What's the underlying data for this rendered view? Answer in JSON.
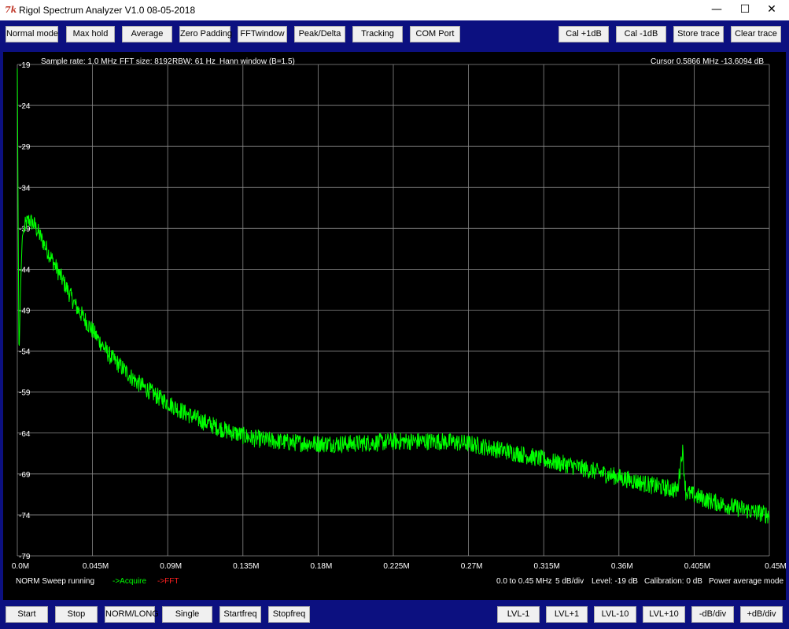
{
  "window": {
    "icon": "tk-feather-icon",
    "title": "Rigol Spectrum Analyzer V1.0 08-05-2018",
    "minimize": "—",
    "maximize": "☐",
    "close": "✕"
  },
  "toolbar_top": {
    "left_buttons": [
      "Normal mode",
      "Max hold",
      "Average",
      "Zero Padding",
      "FFTwindow",
      "Peak/Delta",
      "Tracking",
      "COM Port"
    ],
    "right_buttons": [
      "Cal +1dB",
      "Cal -1dB",
      "Store trace",
      "Clear trace"
    ]
  },
  "toolbar_bottom": {
    "left_buttons": [
      "Start",
      "Stop",
      "NORM/LONG",
      "Single",
      "Startfreq",
      "Stopfreq"
    ],
    "right_buttons": [
      "LVL-1",
      "LVL+1",
      "LVL-10",
      "LVL+10",
      "-dB/div",
      "+dB/div"
    ]
  },
  "header": {
    "sample_rate": "Sample rate: 1.0 MHz",
    "fft_size": "FFT size: 8192",
    "rbw": "RBW: 61 Hz",
    "window": "Hann window (B=1.5)",
    "cursor": "Cursor 0.5866 MHz   -13.6094 dB"
  },
  "footer": {
    "sweep_status": "NORM Sweep running",
    "acquire": "->Acquire",
    "fft": "->FFT",
    "freq_range": "0.0 to 0.45 MHz",
    "db_div": "5 dB/div",
    "level": "Level: -19 dB",
    "calibration": "Calibration: 0 dB",
    "mode": "Power average  mode"
  },
  "colors": {
    "toolbar_bg": "#0c1080",
    "plot_bg": "#000000",
    "grid": "#8a8a8a",
    "trace": "#00ff00",
    "label": "#ffffff",
    "fft_label": "#ff2020"
  },
  "chart_data": {
    "type": "line",
    "xlabel": "",
    "ylabel": "",
    "x_ticks": [
      "0.0M",
      "0.045M",
      "0.09M",
      "0.135M",
      "0.18M",
      "0.225M",
      "0.27M",
      "0.315M",
      "0.36M",
      "0.405M",
      "0.45M"
    ],
    "y_ticks": [
      "-19",
      "-24",
      "-29",
      "-34",
      "-39",
      "-44",
      "-49",
      "-54",
      "-59",
      "-64",
      "-69",
      "-74",
      "-79"
    ],
    "xlim": [
      0,
      0.45
    ],
    "ylim": [
      -79,
      -19
    ],
    "grid": true,
    "series": [
      {
        "x": [
          0.0,
          0.001,
          0.002,
          0.003,
          0.005,
          0.007,
          0.01,
          0.015,
          0.02,
          0.025,
          0.03,
          0.035,
          0.04,
          0.045,
          0.05,
          0.055,
          0.06,
          0.065,
          0.07,
          0.075,
          0.08,
          0.085,
          0.09,
          0.095,
          0.1,
          0.105,
          0.11,
          0.115,
          0.12,
          0.125,
          0.13,
          0.135,
          0.14,
          0.15,
          0.16,
          0.17,
          0.18,
          0.19,
          0.2,
          0.21,
          0.22,
          0.23,
          0.24,
          0.25,
          0.26,
          0.27,
          0.28,
          0.29,
          0.3,
          0.31,
          0.32,
          0.33,
          0.34,
          0.35,
          0.36,
          0.37,
          0.38,
          0.39,
          0.395,
          0.398,
          0.4,
          0.402,
          0.405,
          0.41,
          0.42,
          0.43,
          0.44,
          0.45
        ],
        "y": [
          -19.5,
          -55.0,
          -46.0,
          -40.0,
          -38.5,
          -38.0,
          -38.5,
          -40.5,
          -42.5,
          -44.5,
          -46.5,
          -48.5,
          -50.0,
          -51.5,
          -53.0,
          -54.5,
          -55.5,
          -56.5,
          -57.5,
          -58.3,
          -59.0,
          -59.7,
          -60.3,
          -60.9,
          -61.5,
          -62.0,
          -62.5,
          -62.9,
          -63.3,
          -63.7,
          -64.0,
          -64.3,
          -64.6,
          -64.9,
          -65.1,
          -65.2,
          -65.3,
          -65.3,
          -65.3,
          -65.2,
          -65.1,
          -65.0,
          -65.0,
          -65.0,
          -65.1,
          -65.3,
          -65.7,
          -66.1,
          -66.5,
          -67.0,
          -67.5,
          -67.9,
          -68.4,
          -68.9,
          -69.4,
          -69.9,
          -70.4,
          -70.8,
          -71.0,
          -66.0,
          -71.2,
          -71.4,
          -71.6,
          -72.0,
          -72.6,
          -73.1,
          -73.6,
          -74.0
        ]
      }
    ]
  }
}
